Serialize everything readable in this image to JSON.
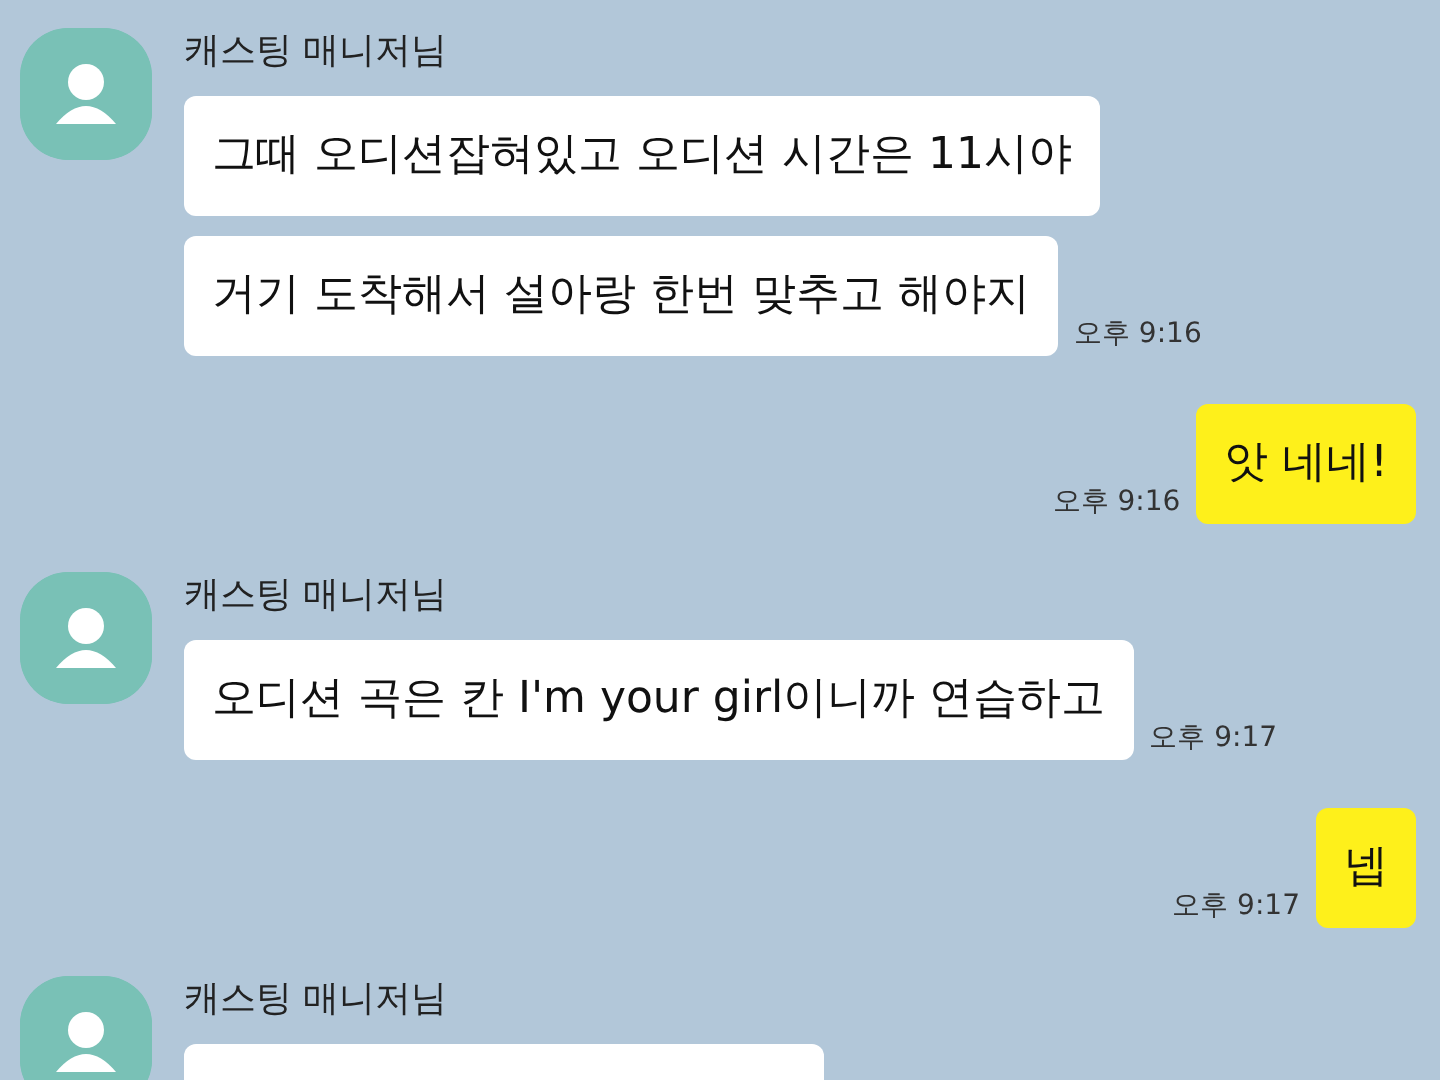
{
  "messages": [
    {
      "kind": "incoming",
      "sender": "캐스팅 매니저님",
      "bubbles": [
        {
          "text": "그때 오디션잡혀있고 오디션 시간은 11시야"
        },
        {
          "text": "거기 도착해서 설아랑 한번 맞추고 해야지",
          "time": "오후 9:16"
        }
      ]
    },
    {
      "kind": "outgoing",
      "bubbles": [
        {
          "text": "앗 네네!",
          "time": "오후 9:16"
        }
      ]
    },
    {
      "kind": "incoming",
      "sender": "캐스팅 매니저님",
      "bubbles": [
        {
          "text": "오디션 곡은 칸 I'm your girl이니까 연습하고",
          "time": "오후 9:17"
        }
      ]
    },
    {
      "kind": "outgoing",
      "bubbles": [
        {
          "text": "넵",
          "time": "오후 9:17"
        }
      ]
    },
    {
      "kind": "incoming",
      "sender": "캐스팅 매니저님",
      "bubbles": [
        {
          "kind": "cut"
        }
      ]
    }
  ]
}
